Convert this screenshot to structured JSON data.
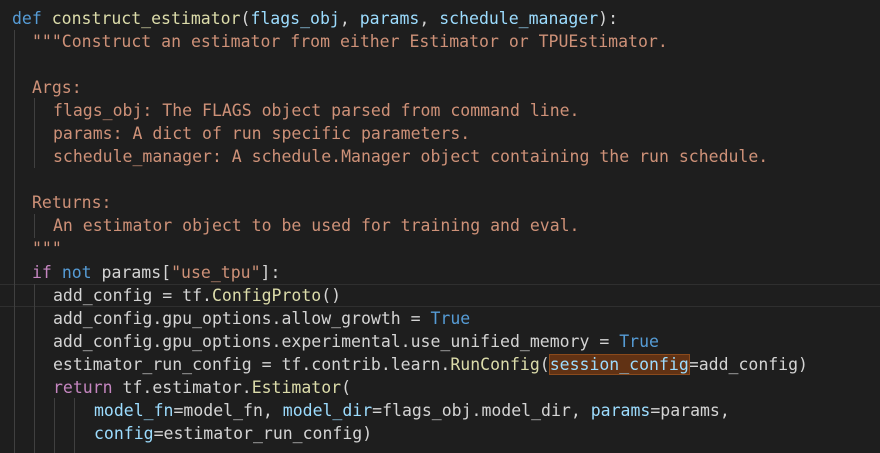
{
  "code": {
    "def_kw": "def",
    "func_name": "construct_estimator",
    "open_paren": "(",
    "p1": "flags_obj",
    "comma_sp": ", ",
    "p2": "params",
    "p3": "schedule_manager",
    "close_colon": "):",
    "doc_line1": "\"\"\"Construct an estimator from either Estimator or TPUEstimator.",
    "doc_args": "Args:",
    "doc_arg1": "flags_obj: The FLAGS object parsed from command line.",
    "doc_arg2": "params: A dict of run specific parameters.",
    "doc_arg3": "schedule_manager: A schedule.Manager object containing the run schedule.",
    "doc_returns": "Returns:",
    "doc_ret1": "An estimator object to be used for training and eval.",
    "doc_end": "\"\"\"",
    "if_kw": "if",
    "not_kw": "not",
    "if_rest_a": " params[",
    "use_tpu_str": "\"use_tpu\"",
    "if_rest_b": "]:",
    "l14_a": "add_config = tf.",
    "l14_fn": "ConfigProto",
    "l14_b": "()",
    "l15_a": "add_config.gpu_options.allow_growth = ",
    "true1": "True",
    "l16_a": "add_config.gpu_options.experimental.use_unified_memory = ",
    "true2": "True",
    "l17_a": "estimator_run_config = tf.contrib.learn.",
    "l17_fn": "RunConfig",
    "l17_paren": "(",
    "l17_kwarg": "session_config",
    "l17_b": "=add_config)",
    "return_kw": "return",
    "l18_a": " tf.estimator.",
    "l18_fn": "Estimator",
    "l18_b": "(",
    "l19_k1": "model_fn",
    "l19_v1": "=model_fn, ",
    "l19_k2": "model_dir",
    "l19_v2": "=flags_obj.model_dir, ",
    "l19_k3": "params",
    "l19_v3": "=params,",
    "l20_k1": "config",
    "l20_v1": "=estimator_run_config)"
  }
}
